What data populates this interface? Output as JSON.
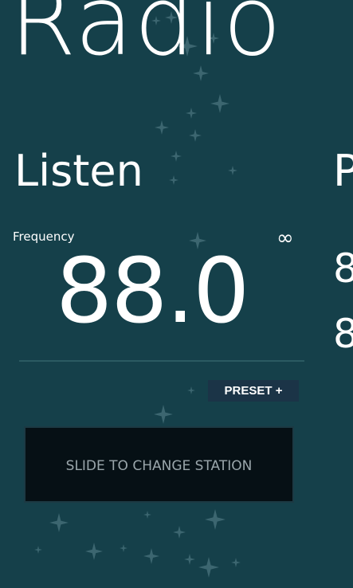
{
  "app": {
    "title": "Radio"
  },
  "pivot": {
    "current": "Listen",
    "next_peek": "P"
  },
  "tuner": {
    "frequency_label": "Frequency",
    "frequency_value": "88.0",
    "loop_symbol": "∞",
    "peek_values": [
      "8",
      "8"
    ]
  },
  "preset": {
    "label": "PRESET +"
  },
  "slider": {
    "label": "SLIDE TO CHANGE STATION"
  },
  "colors": {
    "background": "#15404a",
    "preset_bg": "#1b3447",
    "slider_bg": "#061015",
    "text": "#ffffff"
  }
}
